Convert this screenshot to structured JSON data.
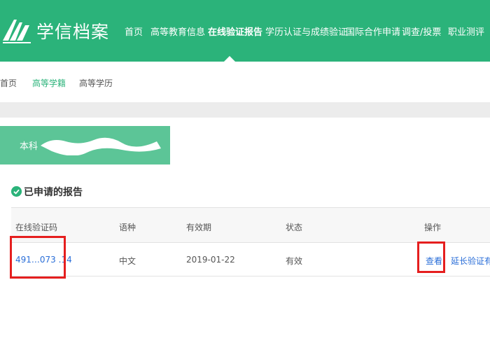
{
  "brand": {
    "name": "学信档案"
  },
  "nav": {
    "items": [
      {
        "label": "首页"
      },
      {
        "label": "高等教育信息"
      },
      {
        "label": "在线验证报告"
      },
      {
        "label": "学历认证与成绩验证"
      },
      {
        "label": "国际合作申请"
      },
      {
        "label": "调查/投票"
      },
      {
        "label": "职业测评"
      }
    ]
  },
  "subnav": {
    "items": [
      {
        "label": "首页"
      },
      {
        "label": "高等学籍"
      },
      {
        "label": "高等学历"
      }
    ]
  },
  "banner": {
    "label": "本科"
  },
  "section": {
    "title": "已申请的报告"
  },
  "table": {
    "headers": [
      "在线验证码",
      "语种",
      "有效期",
      "状态",
      "操作"
    ],
    "row": {
      "code": "491…073 .14",
      "language": "中文",
      "expiry": "2019-01-22",
      "status": "有效",
      "view": "查看",
      "extend": "延长验证有效"
    }
  },
  "colors": {
    "brand_green": "#2bb37a",
    "banner_green": "#5cc597",
    "link_blue": "#2a6ed8",
    "highlight_red": "#e51e1e"
  }
}
